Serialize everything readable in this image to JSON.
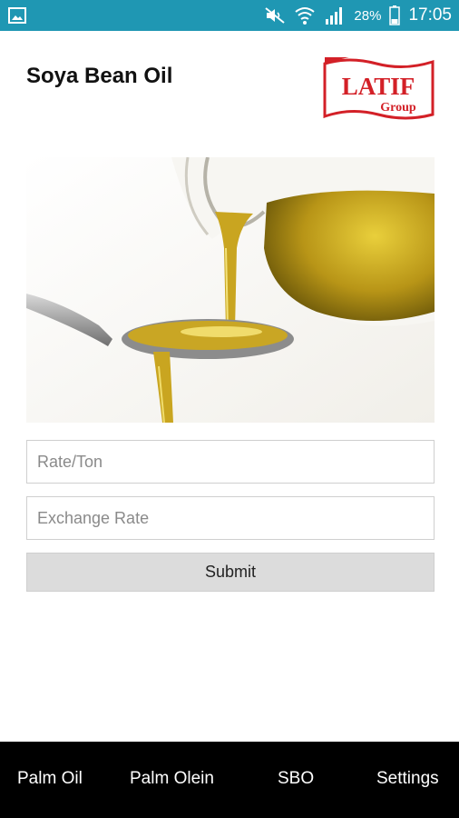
{
  "status_bar": {
    "battery_percent": "28%",
    "time": "17:05",
    "icons": [
      "gallery-icon",
      "mute-icon",
      "wifi-icon",
      "signal-icon",
      "battery-icon"
    ]
  },
  "header": {
    "title": "Soya Bean Oil"
  },
  "logo": {
    "brand": "LATIF",
    "sub": "Group",
    "colors": {
      "primary": "#d32027",
      "background": "#ffffff"
    }
  },
  "hero_image": {
    "subject": "oil-pouring-into-spoon"
  },
  "form": {
    "rate_placeholder": "Rate/Ton",
    "rate_value": "",
    "exchange_placeholder": "Exchange Rate",
    "exchange_value": "",
    "submit_label": "Submit"
  },
  "bottom_nav": {
    "items": [
      {
        "label": "Palm Oil"
      },
      {
        "label": "Palm Olein"
      },
      {
        "label": "SBO"
      },
      {
        "label": "Settings"
      }
    ]
  },
  "colors": {
    "status_bar": "#1f97b3",
    "nav_background": "#000000",
    "button_background": "#dcdcdc"
  }
}
